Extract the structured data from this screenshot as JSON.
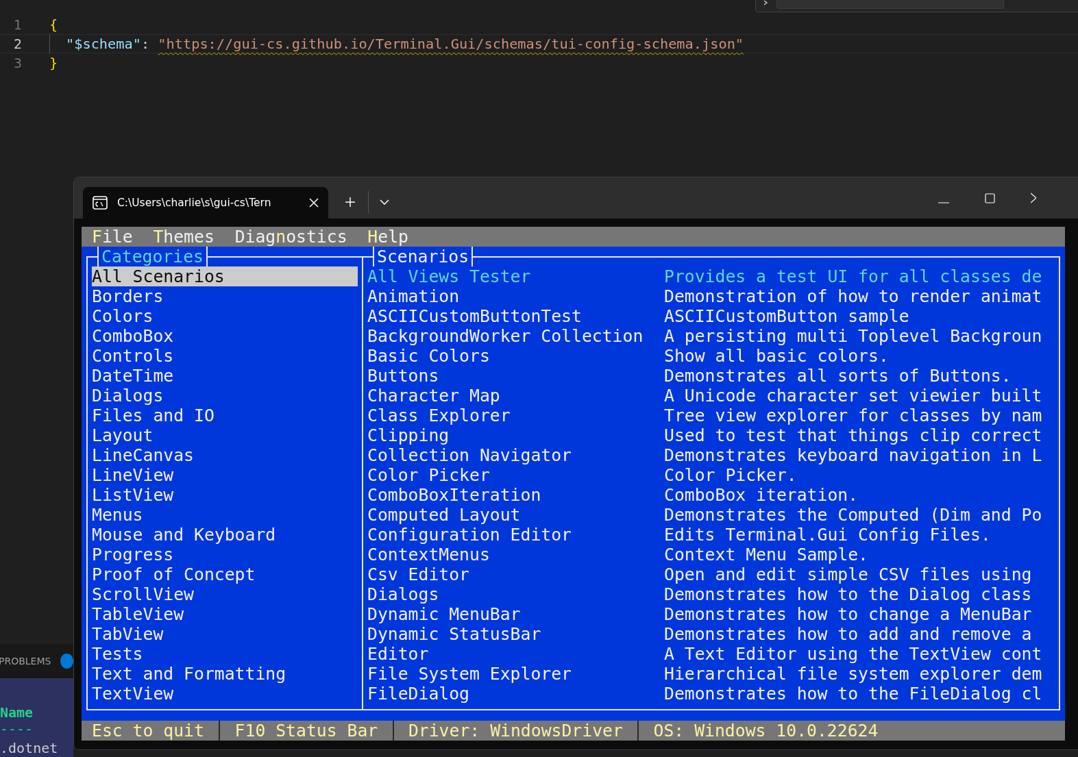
{
  "editor": {
    "lines": [
      {
        "number": "1",
        "current": false,
        "tokens": [
          {
            "kind": "brace",
            "text": "{"
          }
        ]
      },
      {
        "number": "2",
        "current": true,
        "indented": true,
        "tokens": [
          {
            "kind": "key",
            "text": "\"$schema\""
          },
          {
            "kind": "punct",
            "text": ": "
          },
          {
            "kind": "warn-string",
            "text": "\"https://gui-cs.github.io/Terminal.Gui/schemas/tui-config-schema.json\""
          }
        ]
      },
      {
        "number": "3",
        "current": false,
        "tokens": [
          {
            "kind": "brace",
            "text": "}"
          }
        ]
      }
    ]
  },
  "panel": {
    "tab": "PROBLEMS",
    "rows": [
      {
        "kind": "header",
        "text": "Name"
      },
      {
        "kind": "rule",
        "text": "----"
      },
      {
        "kind": "plain",
        "text": ".dotnet"
      }
    ]
  },
  "terminal": {
    "tab": {
      "title": "C:\\Users\\charlie\\s\\gui-cs\\Tern"
    },
    "menu": [
      {
        "key": "F",
        "after": "ile"
      },
      {
        "key": "T",
        "after": "hemes"
      },
      {
        "before": "Diag",
        "key": "n",
        "after": "ostics"
      },
      {
        "key": "H",
        "after": "elp"
      }
    ],
    "categories": {
      "title": "Categories",
      "focused": true,
      "items": [
        {
          "label": "All Scenarios",
          "selected": true
        },
        {
          "label": "Borders",
          "selected": false
        },
        {
          "label": "Colors",
          "selected": false
        },
        {
          "label": "ComboBox",
          "selected": false
        },
        {
          "label": "Controls",
          "selected": false
        },
        {
          "label": "DateTime",
          "selected": false
        },
        {
          "label": "Dialogs",
          "selected": false
        },
        {
          "label": "Files and IO",
          "selected": false
        },
        {
          "label": "Layout",
          "selected": false
        },
        {
          "label": "LineCanvas",
          "selected": false
        },
        {
          "label": "LineView",
          "selected": false
        },
        {
          "label": "ListView",
          "selected": false
        },
        {
          "label": "Menus",
          "selected": false
        },
        {
          "label": "Mouse and Keyboard",
          "selected": false
        },
        {
          "label": "Progress",
          "selected": false
        },
        {
          "label": "Proof of Concept",
          "selected": false
        },
        {
          "label": "ScrollView",
          "selected": false
        },
        {
          "label": "TableView",
          "selected": false
        },
        {
          "label": "TabView",
          "selected": false
        },
        {
          "label": "Tests",
          "selected": false
        },
        {
          "label": "Text and Formatting",
          "selected": false
        },
        {
          "label": "TextView",
          "selected": false
        }
      ]
    },
    "scenarios": {
      "title": "Scenarios",
      "focused": false,
      "items": [
        {
          "name": "All Views Tester",
          "description": "Provides a test UI for all classes de",
          "selected": true
        },
        {
          "name": "Animation",
          "description": "Demonstration of how to render animat",
          "selected": false
        },
        {
          "name": "ASCIICustomButtonTest",
          "description": "ASCIICustomButton sample",
          "selected": false
        },
        {
          "name": "BackgroundWorker Collection",
          "description": "A persisting multi Toplevel Backgroun",
          "selected": false
        },
        {
          "name": "Basic Colors",
          "description": "Show all basic colors.",
          "selected": false
        },
        {
          "name": "Buttons",
          "description": "Demonstrates all sorts of Buttons.",
          "selected": false
        },
        {
          "name": "Character Map",
          "description": "A Unicode character set viewier built",
          "selected": false
        },
        {
          "name": "Class Explorer",
          "description": "Tree view explorer for classes by nam",
          "selected": false
        },
        {
          "name": "Clipping",
          "description": "Used to test that things clip correct",
          "selected": false
        },
        {
          "name": "Collection Navigator",
          "description": "Demonstrates keyboard navigation in L",
          "selected": false
        },
        {
          "name": "Color Picker",
          "description": "Color Picker.",
          "selected": false
        },
        {
          "name": "ComboBoxIteration",
          "description": "ComboBox iteration.",
          "selected": false
        },
        {
          "name": "Computed Layout",
          "description": "Demonstrates the Computed (Dim and Po",
          "selected": false
        },
        {
          "name": "Configuration Editor",
          "description": "Edits Terminal.Gui Config Files.",
          "selected": false
        },
        {
          "name": "ContextMenus",
          "description": "Context Menu Sample.",
          "selected": false
        },
        {
          "name": "Csv Editor",
          "description": "Open and edit simple CSV files using",
          "selected": false
        },
        {
          "name": "Dialogs",
          "description": "Demonstrates how to the Dialog class",
          "selected": false
        },
        {
          "name": "Dynamic MenuBar",
          "description": "Demonstrates how to change a MenuBar",
          "selected": false
        },
        {
          "name": "Dynamic StatusBar",
          "description": "Demonstrates how to add and remove a",
          "selected": false
        },
        {
          "name": "Editor",
          "description": "A Text Editor using the TextView cont",
          "selected": false
        },
        {
          "name": "File System Explorer",
          "description": "Hierarchical file system explorer dem",
          "selected": false
        },
        {
          "name": "FileDialog",
          "description": "Demonstrates how to the FileDialog cl",
          "selected": false
        }
      ]
    },
    "status": [
      "Esc to quit",
      "F10 Status Bar",
      "Driver: WindowsDriver",
      "OS: Windows 10.0.22624"
    ]
  }
}
